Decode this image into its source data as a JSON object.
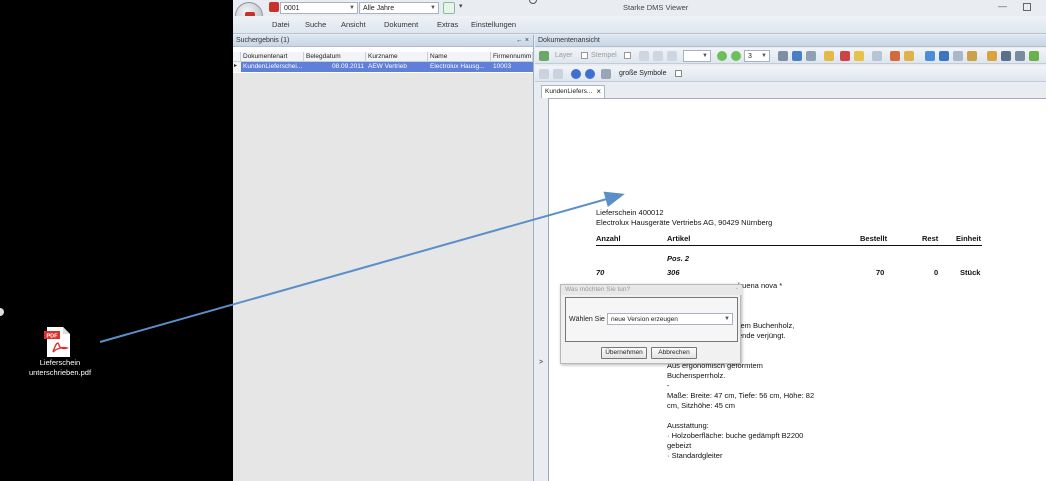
{
  "desktop": {
    "file_icon": "pdf-file-icon",
    "file_label_line1": "Lieferschein",
    "file_label_line2": "unterschrieben.pdf"
  },
  "window": {
    "title": "Starke DMS Viewer",
    "combo_number": "0001",
    "combo_years": "Alle Jahre"
  },
  "menu": [
    "Datei",
    "Suche",
    "Ansicht",
    "Dokument",
    "Extras",
    "Einstellungen"
  ],
  "left_pane": {
    "title": "Suchergebnis (1)",
    "pin": "← ×",
    "columns": [
      "Dokumentenart",
      "Belegdatum",
      "Kurzname",
      "Name",
      "Firmennumm"
    ],
    "row": [
      "KundenLieferschei...",
      "08.09.2011",
      "AEW Vertrieb",
      "Electrolux Hausg...",
      "10003"
    ]
  },
  "right_pane": {
    "title": "Dokumentenansicht",
    "layer_label": "Layer",
    "stempel_label": "Stempel",
    "page_value": "3",
    "big_symbols_label": "große Symbole",
    "doc_tab_label": "KundenLiefers...",
    "doc_tab_close": "×",
    "side_arrow": ">"
  },
  "document": {
    "line1": "Lieferschein 400012",
    "line2": "Electrolux Hausgeräte Vertriebs AG, 90429 Nürnberg",
    "headers": [
      "Anzahl",
      "Artikel",
      "Bestellt",
      "Rest",
      "Einheit"
    ],
    "pos": "Pos. 2",
    "row": [
      "70",
      "306",
      "70",
      "0",
      "Stück"
    ],
    "frag1": "buena nova *",
    "frag2": "rem Buchenholz,",
    "frag3": "ende verjüngt.",
    "desc1": "Aus ergonomisch geformtem",
    "desc2": "Buchensperrholz.",
    "desc3": "-",
    "desc4": "Maße: Breite: 47 cm, Tiefe: 56 cm, Höhe: 82",
    "desc5": "cm, Sitzhöhe: 45 cm",
    "desc6": "Ausstattung:",
    "desc7": "· Holzoberfläche: buche gedämpft B2200",
    "desc8": "gebeizt",
    "desc9": "· Standardgleiter"
  },
  "dialog": {
    "title": "Was möchten Sie tun?",
    "label": "Wählen Sie",
    "select_value": "neue Version erzeugen",
    "ok": "Übernehmen",
    "cancel": "Abbrechen"
  },
  "colors": {
    "arrow": "#5b8fc7",
    "selection": "#5f7fd8",
    "pdf_red": "#d9302c"
  }
}
